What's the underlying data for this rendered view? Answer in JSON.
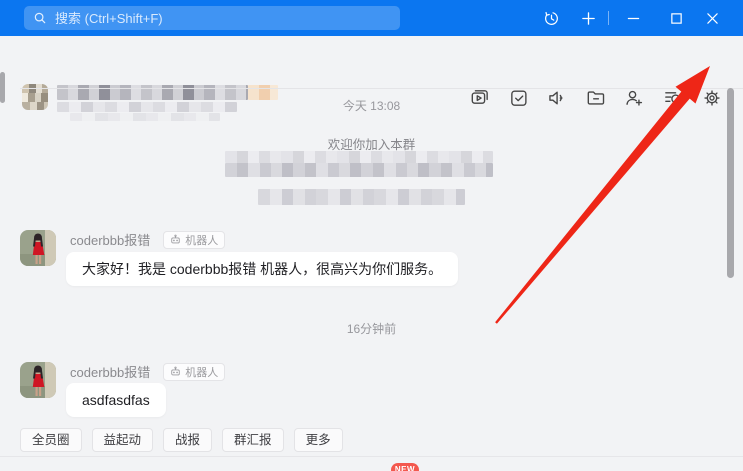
{
  "titlebar": {
    "search_placeholder": "搜索 (Ctrl+Shift+F)",
    "icons": [
      "search-icon",
      "history-icon",
      "add-icon",
      "minimize-icon",
      "maximize-icon",
      "close-icon"
    ]
  },
  "header": {
    "icons": [
      "group-video-icon",
      "task-check-icon",
      "announcement-speaker-icon",
      "group-files-folder-icon",
      "add-member-icon",
      "chat-history-search-icon",
      "settings-gear-icon"
    ]
  },
  "chat": {
    "date_label": "今天 13:08",
    "welcome_text": "欢迎你加入本群",
    "relative_time": "16分钟前",
    "messages": [
      {
        "sender": "coderbbb报错",
        "badge": "机器人",
        "text": "大家好！我是 coderbbb报错 机器人，很高兴为你们服务。"
      },
      {
        "sender": "coderbbb报错",
        "badge": "机器人",
        "text": "asdfasdfas"
      }
    ]
  },
  "tabs": [
    "全员圈",
    "益起动",
    "战报",
    "群汇报",
    "更多"
  ],
  "footer": {
    "new_badge": "NEW"
  },
  "colors": {
    "titlebar_blue": "#0b76f0",
    "arrow_red": "#ee2617",
    "new_badge_red": "#f3584e",
    "chat_background": "#f2f3f5"
  }
}
